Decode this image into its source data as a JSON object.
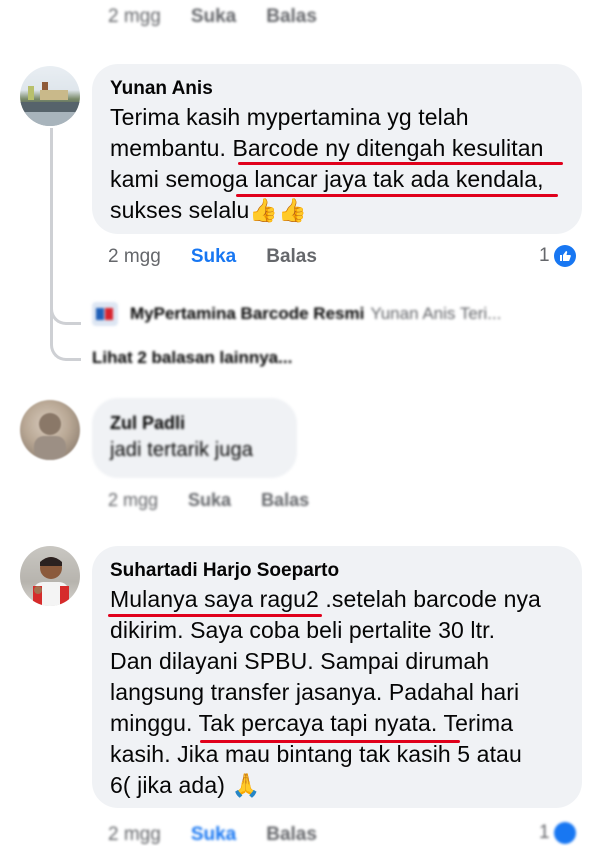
{
  "top_actions": {
    "time": "2 mgg",
    "like": "Suka",
    "reply": "Balas"
  },
  "comments": [
    {
      "name": "Yunan Anis",
      "lines": [
        "Terima kasih mypertamina yg telah",
        "membantu. Barcode ny ditengah kesulitan",
        "kami semoga lancar jaya tak ada kendala,",
        "sukses selalu👍👍"
      ],
      "time": "2 mgg",
      "like": "Suka",
      "reply": "Balas",
      "reaction_count": "1",
      "reply_preview": {
        "page_name": "MyPertamina Barcode Resmi",
        "snippet": "Yunan Anis Teri..."
      },
      "more_replies": "Lihat 2 balasan lainnya..."
    },
    {
      "name": "Zul Padli",
      "lines": [
        "jadi tertarik juga"
      ],
      "time": "2 mgg",
      "like": "Suka",
      "reply": "Balas"
    },
    {
      "name": "Suhartadi Harjo Soeparto",
      "lines": [
        "Mulanya saya ragu2 .setelah barcode nya",
        "dikirim. Saya coba beli pertalite 30 ltr.",
        "Dan dilayani SPBU. Sampai dirumah",
        "langsung transfer jasanya. Padahal hari",
        "minggu. Tak percaya tapi nyata. Terima",
        "kasih. Jika mau bintang tak kasih 5 atau",
        "6( jika ada) 🙏"
      ],
      "time": "2 mgg",
      "like": "Suka",
      "reply": "Balas",
      "reaction_count": "1"
    }
  ],
  "colors": {
    "bubble": "#f0f2f5",
    "like_active": "#1877f2",
    "underline": "#e0001b",
    "muted": "#65676b"
  }
}
